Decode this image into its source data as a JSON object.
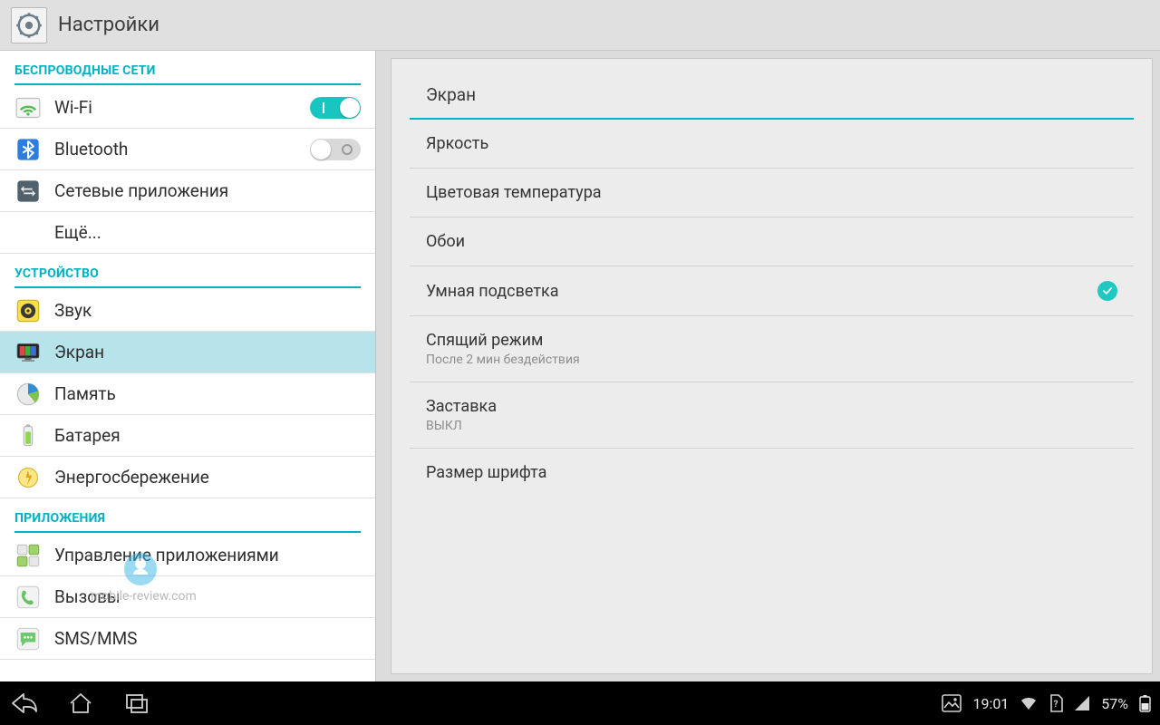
{
  "app": {
    "title": "Настройки"
  },
  "watermark": "mobile-review.com",
  "sidebar": {
    "sections": [
      {
        "header": "БЕСПРОВОДНЫЕ СЕТИ",
        "items": [
          {
            "label": "Wi-Fi",
            "toggle": "on"
          },
          {
            "label": "Bluetooth",
            "toggle": "off"
          },
          {
            "label": "Сетевые приложения"
          },
          {
            "label": "Ещё...",
            "indent": true
          }
        ]
      },
      {
        "header": "УСТРОЙСТВО",
        "items": [
          {
            "label": "Звук"
          },
          {
            "label": "Экран",
            "selected": true
          },
          {
            "label": "Память"
          },
          {
            "label": "Батарея"
          },
          {
            "label": "Энергосбережение"
          }
        ]
      },
      {
        "header": "ПРИЛОЖЕНИЯ",
        "items": [
          {
            "label": "Управление приложениями"
          },
          {
            "label": "Вызовы"
          },
          {
            "label": "SMS/MMS"
          }
        ]
      }
    ]
  },
  "detail": {
    "title": "Экран",
    "rows": [
      {
        "label": "Яркость"
      },
      {
        "label": "Цветовая температура"
      },
      {
        "label": "Обои"
      },
      {
        "label": "Умная подсветка",
        "checked": true
      },
      {
        "label": "Спящий режим",
        "sub": "После 2 мин бездействия"
      },
      {
        "label": "Заставка",
        "sub": "ВЫКЛ"
      },
      {
        "label": "Размер шрифта"
      }
    ]
  },
  "statusbar": {
    "time": "19:01",
    "battery_pct": "57%"
  }
}
